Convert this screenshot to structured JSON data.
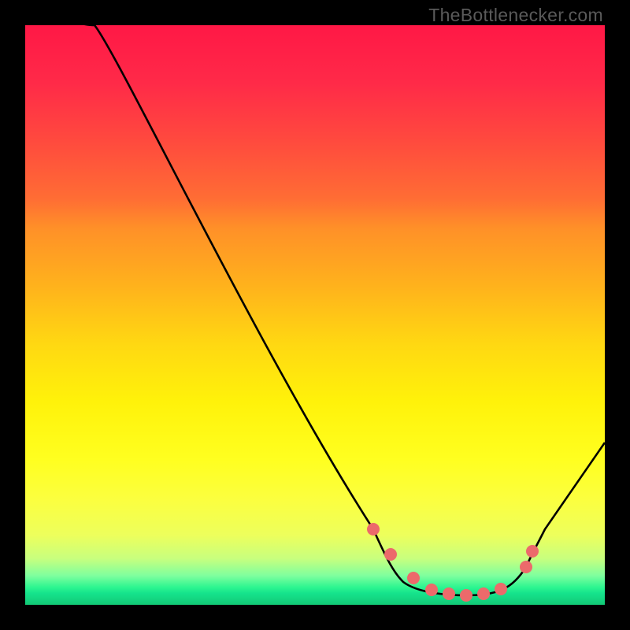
{
  "watermark": "TheBottlenecker.com",
  "chart_data": {
    "type": "line",
    "title": "",
    "xlabel": "",
    "ylabel": "",
    "xlim": [
      0,
      100
    ],
    "ylim": [
      0,
      100
    ],
    "x": [
      0,
      12,
      60,
      64,
      68,
      72,
      76,
      80,
      84,
      87,
      100
    ],
    "values": [
      103,
      100,
      13,
      8,
      5,
      3,
      2,
      3,
      5,
      9,
      28
    ],
    "markers": {
      "x": [
        60,
        63,
        67,
        70,
        73,
        76,
        79,
        82,
        86.5,
        87.5
      ],
      "values": [
        13,
        9,
        5,
        3,
        2.5,
        2,
        2.5,
        3,
        7,
        9.5
      ]
    },
    "gradient_stops": [
      {
        "pct": 0,
        "color": "#ff1846"
      },
      {
        "pct": 35,
        "color": "#ff9028"
      },
      {
        "pct": 65,
        "color": "#fff20a"
      },
      {
        "pct": 95,
        "color": "#7eff9e"
      },
      {
        "pct": 100,
        "color": "#12c976"
      }
    ]
  }
}
